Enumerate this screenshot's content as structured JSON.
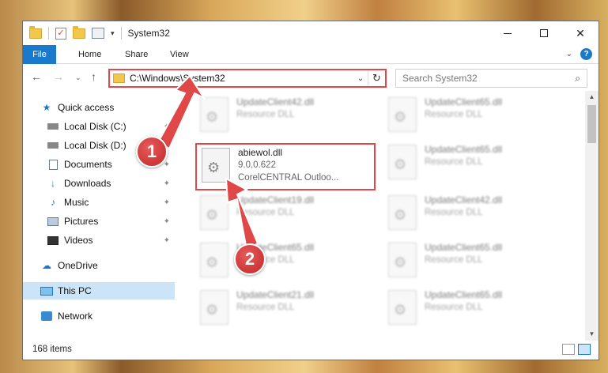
{
  "window": {
    "title": "System32",
    "close_glyph": "✕"
  },
  "ribbon": {
    "tabs": [
      {
        "label": "File"
      },
      {
        "label": "Home"
      },
      {
        "label": "Share"
      },
      {
        "label": "View"
      }
    ],
    "help_glyph": "?"
  },
  "navigation": {
    "back_glyph": "←",
    "forward_glyph": "→",
    "recent_glyph": "⌄",
    "up_glyph": "↑",
    "address": "C:\\Windows\\System32",
    "address_dd_glyph": "⌄",
    "refresh_glyph": "↻",
    "search_placeholder": "Search System32",
    "search_glyph": "⌕"
  },
  "sidebar": {
    "items": [
      {
        "label": "Quick access"
      },
      {
        "label": "Local Disk (C:)"
      },
      {
        "label": "Local Disk (D:)"
      },
      {
        "label": "Documents"
      },
      {
        "label": "Downloads"
      },
      {
        "label": "Music"
      },
      {
        "label": "Pictures"
      },
      {
        "label": "Videos"
      },
      {
        "label": "OneDrive"
      },
      {
        "label": "This PC"
      },
      {
        "label": "Network"
      }
    ]
  },
  "files": [
    {
      "name": "UpdateClient42.dll",
      "sub": "Resource DLL"
    },
    {
      "name": "UpdateClient65.dll",
      "sub": "Resource DLL"
    },
    {
      "name": "abiewol.dll",
      "version": "9.0.0.622",
      "sub": "CorelCENTRAL Outloo..."
    },
    {
      "name": "UpdateClient65.dll",
      "sub": "Resource DLL"
    },
    {
      "name": "UpdateClient19.dll",
      "sub": "Resource DLL"
    },
    {
      "name": "UpdateClient42.dll",
      "sub": "Resource DLL"
    },
    {
      "name": "UpdateClient65.dll",
      "sub": "Resource DLL"
    },
    {
      "name": "UpdateClient65.dll",
      "sub": "Resource DLL"
    },
    {
      "name": "UpdateClient21.dll",
      "sub": "Resource DLL"
    },
    {
      "name": "UpdateClient65.dll",
      "sub": "Resource DLL"
    }
  ],
  "status": {
    "item_count": "168 items"
  },
  "annotations": {
    "step1": "1",
    "step2": "2"
  },
  "colors": {
    "accent": "#1979ca",
    "highlight_border": "#e04848",
    "marker": "#c02828"
  }
}
